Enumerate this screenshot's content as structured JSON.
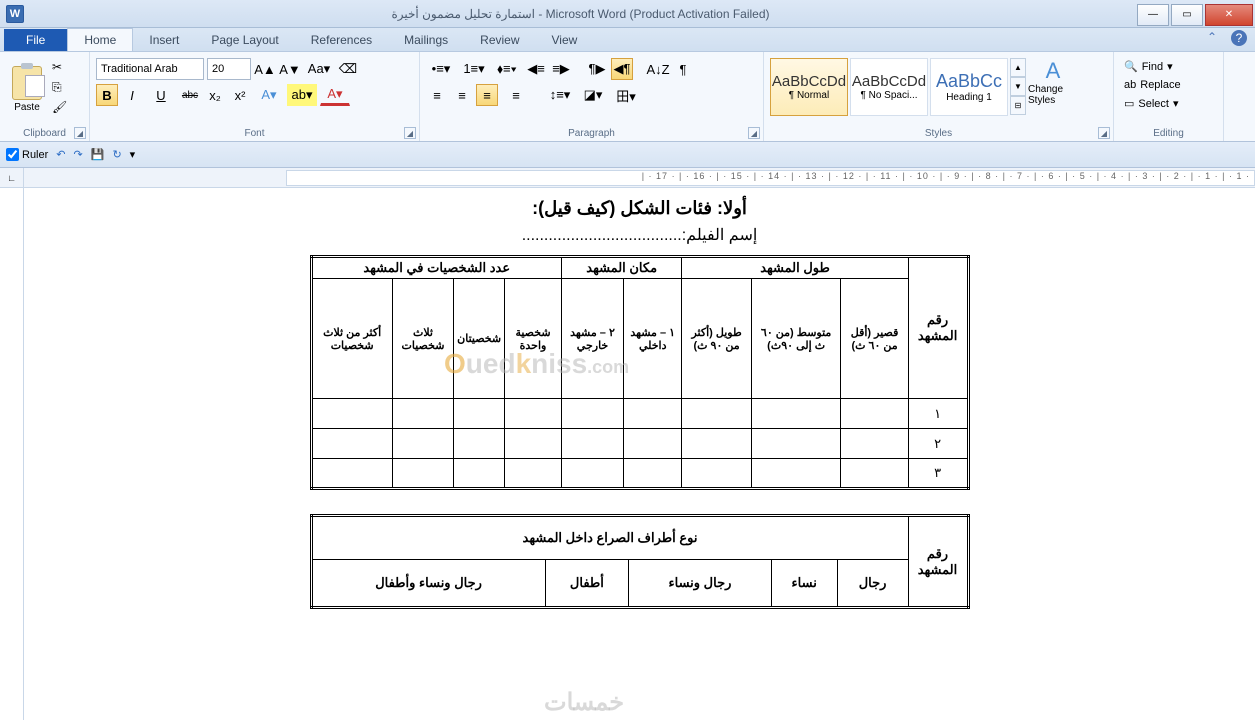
{
  "window": {
    "app_icon_letter": "W",
    "title": "استمارة تحليل مضمون أخيرة - Microsoft Word (Product Activation Failed)"
  },
  "win_controls": {
    "min": "—",
    "max": "▭",
    "close": "✕"
  },
  "tabs": {
    "file": "File",
    "items": [
      "Home",
      "Insert",
      "Page Layout",
      "References",
      "Mailings",
      "Review",
      "View"
    ],
    "active": "Home"
  },
  "help": {
    "caret": "⌃",
    "q": "?"
  },
  "ribbon": {
    "clipboard": {
      "label": "Clipboard",
      "paste": "Paste"
    },
    "font": {
      "label": "Font",
      "name": "Traditional Arab",
      "size": "20",
      "grow": "A▲",
      "shrink": "A▼",
      "case": "Aa▾",
      "clear": "⌫",
      "bold": "B",
      "italic": "I",
      "underline": "U",
      "strike": "abc",
      "sub": "x₂",
      "sup": "x²",
      "effects": "A▾",
      "highlight": "ab▾",
      "color": "A▾"
    },
    "paragraph": {
      "label": "Paragraph",
      "bullets": "•≡▾",
      "numbers": "1≡▾",
      "multi": "⬧≡▾",
      "dec_indent": "◀≡",
      "inc_indent": "≡▶",
      "sort": "A↓Z",
      "marks": "¶",
      "left": "≡",
      "center": "≡",
      "right": "≡",
      "justify": "≡",
      "spacing": "↕≡▾",
      "shading": "◪▾",
      "borders": "田▾",
      "ltr": "¶▶",
      "rtl": "◀¶"
    },
    "styles": {
      "label": "Styles",
      "items": [
        {
          "preview": "AaBbCcDd",
          "name": "¶ Normal",
          "sel": true
        },
        {
          "preview": "AaBbCcDd",
          "name": "¶ No Spaci..."
        },
        {
          "preview": "AaBbCc",
          "name": "Heading 1",
          "h1": true
        }
      ],
      "change": "Change Styles"
    },
    "editing": {
      "label": "Editing",
      "find": "Find",
      "replace": "Replace",
      "select": "Select"
    }
  },
  "qat": {
    "ruler_chk": true,
    "ruler_label": "Ruler",
    "undo": "↶",
    "redo": "↷",
    "save": "💾",
    "refresh": "↻"
  },
  "ruler_text": "· 1 · | · 1 · | · 2 · | · 3 · | · 4 · | · 5 · | · 6 · | · 7 · | · 8 · | · 9 · | · 10 · | · 11 · | · 12 · | · 13 · | · 14 · | · 15 · | · 16 · | · 17 · |",
  "doc": {
    "heading": "أولا: فئات الشكل (كيف قيل):",
    "film_label": "إسم الفيلم:",
    "dots": "....................................",
    "t1": {
      "h_scene_no": "رقم المشهد",
      "h_length": "طول المشهد",
      "h_place": "مكان المشهد",
      "h_chars": "عدد الشخصيات في المشهد",
      "len_short": "قصير (أقل من ٦٠ ث)",
      "len_mid": "متوسط (من ٦٠ ث إلى ٩٠ث)",
      "len_long": "طويل (أكثر من ٩٠ ث)",
      "place_in": "١ – مشهد داخلي",
      "place_out": "٢ – مشهد خارجي",
      "ch_one": "شخصية واحدة",
      "ch_two": "شخصيتان",
      "ch_three": "ثلاث شخصيات",
      "ch_more": "أكثر من ثلاث شخصيات",
      "rows": [
        "١",
        "٢",
        "٣"
      ]
    },
    "t2": {
      "h_scene_no": "رقم المشهد",
      "h_parties": "نوع أطراف الصراع داخل المشهد",
      "men": "رجال",
      "women": "نساء",
      "menwomen": "رجال ونساء",
      "children": "أطفال",
      "all": "رجال ونساء وأطفال"
    }
  },
  "watermarks": {
    "ouedkniss": "Ouedkniss.com",
    "khamsat": "خمسات"
  }
}
